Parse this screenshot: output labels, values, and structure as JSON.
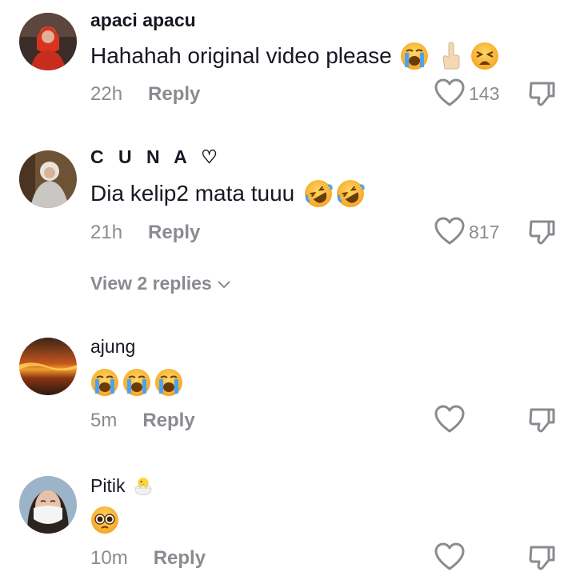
{
  "comments": [
    {
      "username": "apaci apacu",
      "text": "Hahahah original video please",
      "emojis": [
        "loudly-crying-face",
        "index-pointing-up",
        "weary-face"
      ],
      "time": "22h",
      "reply_label": "Reply",
      "likes": "143"
    },
    {
      "username": "C U N A ♡",
      "text": "Dia kelip2 mata tuuu",
      "emojis": [
        "rolling-on-floor-laughing",
        "rolling-on-floor-laughing"
      ],
      "time": "21h",
      "reply_label": "Reply",
      "likes": "817",
      "view_replies": "View 2 replies"
    },
    {
      "username": "ajung",
      "text": "",
      "emojis": [
        "loudly-crying-face",
        "loudly-crying-face",
        "loudly-crying-face"
      ],
      "time": "5m",
      "reply_label": "Reply",
      "likes": ""
    },
    {
      "username": "Pitik",
      "username_emoji": "hatching-chick",
      "text": "",
      "emojis": [
        "pleading-face"
      ],
      "time": "10m",
      "reply_label": "Reply",
      "likes": ""
    }
  ],
  "colors": {
    "text": "#161823",
    "secondary": "#8a8b91",
    "background": "#ffffff"
  },
  "icons": {
    "like": "heart-outline-icon",
    "dislike": "thumbs-down-icon",
    "expand": "chevron-down-icon"
  }
}
